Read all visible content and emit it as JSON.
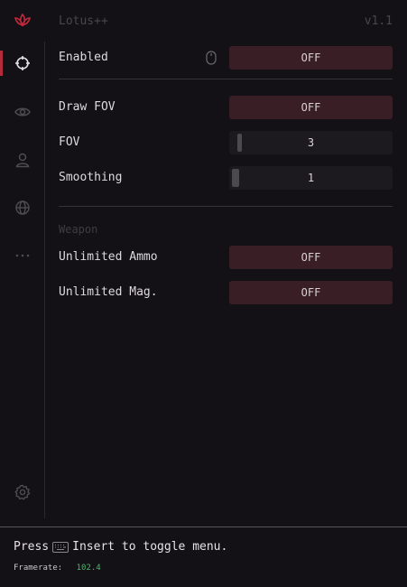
{
  "app": {
    "title": "Lotus++",
    "version": "v1.1",
    "brand_color": "#b42b3d"
  },
  "sidebar": {
    "items": [
      {
        "icon": "crosshair-icon",
        "active": true
      },
      {
        "icon": "eye-icon",
        "active": false
      },
      {
        "icon": "user-icon",
        "active": false
      },
      {
        "icon": "globe-icon",
        "active": false
      },
      {
        "icon": "more-icon",
        "active": false
      }
    ],
    "bottom_icon": "gear-icon"
  },
  "settings": {
    "enabled": {
      "label": "Enabled",
      "value": "OFF"
    },
    "draw_fov": {
      "label": "Draw FOV",
      "value": "OFF"
    },
    "fov": {
      "label": "FOV",
      "value": "3"
    },
    "smoothing": {
      "label": "Smoothing",
      "value": "1"
    }
  },
  "weapon": {
    "section_title": "Weapon",
    "unlimited_ammo": {
      "label": "Unlimited Ammo",
      "value": "OFF"
    },
    "unlimited_mag": {
      "label": "Unlimited Mag.",
      "value": "OFF"
    }
  },
  "footer": {
    "press": "Press",
    "hint": "Insert to toggle menu.",
    "framerate_label": "Framerate:",
    "framerate_value": "102.4"
  }
}
